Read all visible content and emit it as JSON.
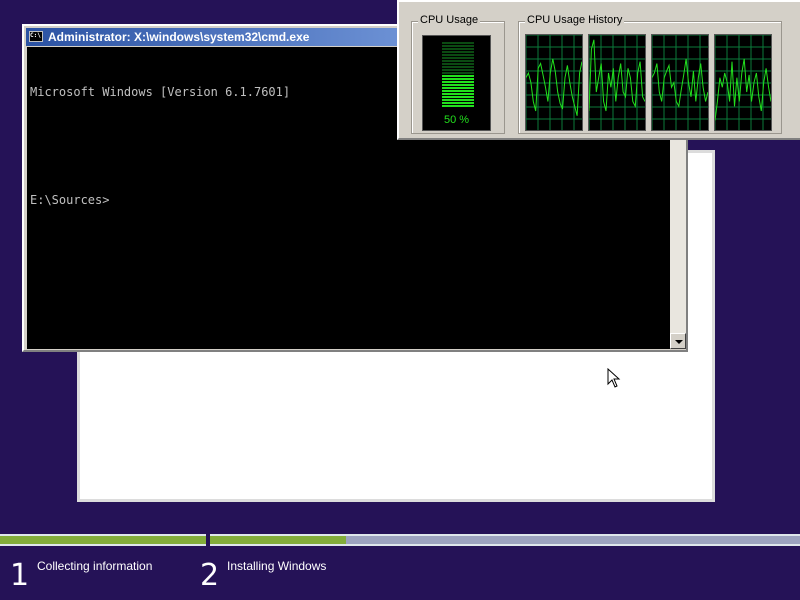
{
  "cmd": {
    "title": "Administrator: X:\\windows\\system32\\cmd.exe",
    "icon": "cmd-console-icon",
    "lines": [
      "Microsoft Windows [Version 6.1.7601]",
      "",
      "E:\\Sources>"
    ]
  },
  "taskmgr": {
    "cpu_usage_label": "CPU Usage",
    "cpu_history_label": "CPU Usage History",
    "cpu_percent": 50,
    "cpu_percent_text": "50 %",
    "meter_segments": 22,
    "meter_lit_segments": 11,
    "history_series": [
      [
        55,
        60,
        50,
        30,
        20,
        65,
        70,
        58,
        45,
        30,
        60,
        75,
        62,
        40,
        28,
        22,
        55,
        68,
        50,
        35,
        25,
        15,
        60,
        72
      ],
      [
        20,
        85,
        95,
        40,
        55,
        70,
        30,
        20,
        60,
        45,
        65,
        30,
        55,
        70,
        40,
        35,
        65,
        55,
        30,
        25,
        60,
        72,
        35,
        30
      ],
      [
        55,
        60,
        70,
        40,
        30,
        55,
        62,
        68,
        45,
        50,
        30,
        25,
        42,
        58,
        75,
        50,
        35,
        62,
        30,
        55,
        70,
        45,
        30,
        40
      ],
      [
        10,
        30,
        55,
        45,
        60,
        50,
        30,
        72,
        25,
        55,
        30,
        60,
        75,
        40,
        58,
        30,
        50,
        60,
        35,
        20,
        50,
        65,
        45,
        30
      ]
    ],
    "colors": {
      "grid": "#0b7a3a",
      "line": "#22e01d",
      "meter_on": "#22e01d",
      "meter_off": "#0b4a12"
    }
  },
  "setup": {
    "steps": [
      {
        "number": "1",
        "label": "Collecting information",
        "progress": 1.0
      },
      {
        "number": "2",
        "label": "Installing Windows",
        "progress": 0.23
      }
    ],
    "colors": {
      "background": "#251257",
      "progress_done": "#83ad3b",
      "progress_todo": "#9da3bf"
    }
  },
  "cursor": "mouse-pointer-icon"
}
